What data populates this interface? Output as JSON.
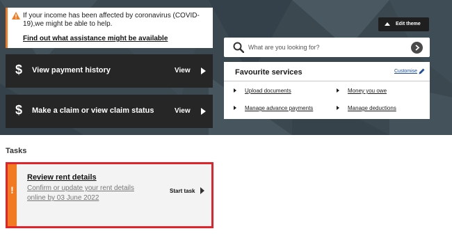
{
  "theme": {
    "accent": "#f27a21",
    "highlight": "#e0242b",
    "tile": "#262626",
    "link": "#1c4fa0"
  },
  "alert": {
    "icon": "warning-icon",
    "message": "If your income has been affected by coronavirus (COVID-19),we might be able to help.",
    "link": "Find out what assistance might be available"
  },
  "tiles": [
    {
      "icon": "dollar-icon",
      "label": "View payment history",
      "action": "View"
    },
    {
      "icon": "dollar-icon",
      "label": "Make a claim or view claim status",
      "action": "View"
    }
  ],
  "edit_theme": {
    "icon": "palette-icon",
    "label": "Edit theme"
  },
  "search": {
    "icon": "search-icon",
    "placeholder": "What are you looking for?",
    "submit_icon": "chevron-right-icon"
  },
  "favourites": {
    "title": "Favourite services",
    "customise": "Customise",
    "items": [
      "Upload documents",
      "Money you owe",
      "Manage advance payments",
      "Manage deductions"
    ]
  },
  "tasks": {
    "heading": "Tasks",
    "card": {
      "title": "Review rent details",
      "description": "Confirm or update your rent details online by 03 June 2022",
      "action": "Start task"
    }
  }
}
